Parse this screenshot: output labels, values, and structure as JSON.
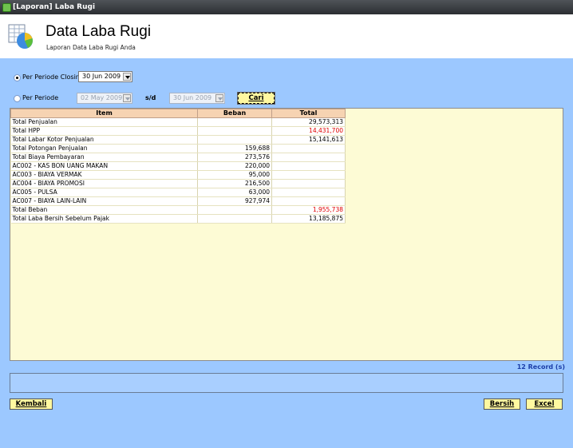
{
  "window": {
    "title": "[Laporan] Laba Rugi"
  },
  "header": {
    "title": "Data Laba Rugi",
    "subtitle": "Laporan Data Laba Rugi Anda"
  },
  "filters": {
    "per_periode_closing_label": "Per Periode Closing",
    "closing_date": "30 Jun 2009",
    "per_periode_label": "Per Periode",
    "from_date": "02 May 2009",
    "sd_label": "s/d",
    "to_date": "30 Jun 2009",
    "cari_label": "Cari"
  },
  "table": {
    "columns": [
      "Item",
      "Beban",
      "Total"
    ],
    "rows": [
      {
        "item": "Total Penjualan",
        "beban": "",
        "total": "29,573,313",
        "red": false
      },
      {
        "item": "Total HPP",
        "beban": "",
        "total": "14,431,700",
        "red": true
      },
      {
        "item": "Total Labar Kotor Penjualan",
        "beban": "",
        "total": "15,141,613",
        "red": false
      },
      {
        "item": "Total Potongan Penjualan",
        "beban": "159,688",
        "total": "",
        "red": false
      },
      {
        "item": "Total Biaya Pembayaran",
        "beban": "273,576",
        "total": "",
        "red": false
      },
      {
        "item": "AC002 - KAS BON UANG MAKAN",
        "beban": "220,000",
        "total": "",
        "red": false
      },
      {
        "item": "AC003 - BIAYA VERMAK",
        "beban": "95,000",
        "total": "",
        "red": false
      },
      {
        "item": "AC004 - BIAYA PROMOSI",
        "beban": "216,500",
        "total": "",
        "red": false
      },
      {
        "item": "AC005 - PULSA",
        "beban": "63,000",
        "total": "",
        "red": false
      },
      {
        "item": "AC007 - BIAYA LAIN-LAIN",
        "beban": "927,974",
        "total": "",
        "red": false
      },
      {
        "item": "Total Beban",
        "beban": "",
        "total": "1,955,738",
        "red": true
      },
      {
        "item": "Total Laba Bersih Sebelum Pajak",
        "beban": "",
        "total": "13,185,875",
        "red": false
      }
    ]
  },
  "record_count": "12 Record (s)",
  "buttons": {
    "kembali": "Kembali",
    "bersih": "Bersih",
    "excel": "Excel"
  },
  "colors": {
    "background": "#9cc8ff",
    "grid": "#fdfbd5",
    "header_row": "#f6d3b2",
    "button": "#fff8a0",
    "negative": "#e00000",
    "record": "#1c3ea8"
  }
}
